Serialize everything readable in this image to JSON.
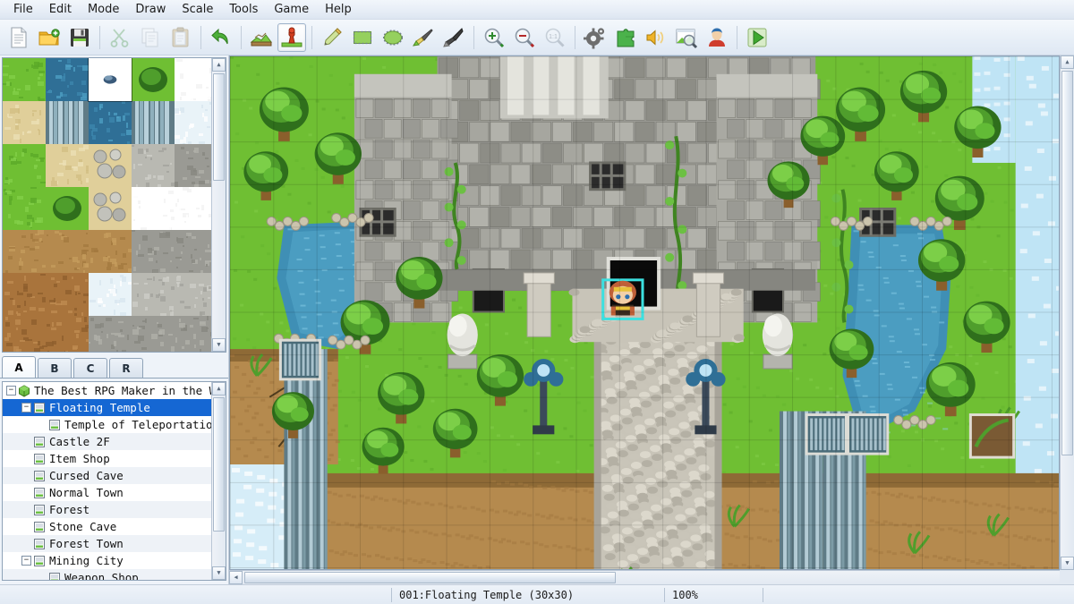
{
  "app": {
    "title": "The Best RPG Maker in the World"
  },
  "menubar": {
    "items": [
      {
        "label": "File"
      },
      {
        "label": "Edit"
      },
      {
        "label": "Mode"
      },
      {
        "label": "Draw"
      },
      {
        "label": "Scale"
      },
      {
        "label": "Tools"
      },
      {
        "label": "Game"
      },
      {
        "label": "Help"
      }
    ]
  },
  "toolbar": {
    "groups": [
      {
        "buttons": [
          {
            "name": "new-project-button",
            "icon": "new-document-icon",
            "enabled": true,
            "active": false
          },
          {
            "name": "open-project-button",
            "icon": "open-folder-icon",
            "enabled": true,
            "active": false
          },
          {
            "name": "save-project-button",
            "icon": "floppy-save-icon",
            "enabled": true,
            "active": false
          }
        ]
      },
      {
        "buttons": [
          {
            "name": "cut-button",
            "icon": "scissors-icon",
            "enabled": false,
            "active": false
          },
          {
            "name": "copy-button",
            "icon": "copy-pages-icon",
            "enabled": false,
            "active": false
          },
          {
            "name": "paste-button",
            "icon": "clipboard-icon",
            "enabled": false,
            "active": false
          }
        ]
      },
      {
        "buttons": [
          {
            "name": "undo-button",
            "icon": "undo-arrow-icon",
            "enabled": true,
            "active": false
          }
        ]
      },
      {
        "buttons": [
          {
            "name": "map-mode-button",
            "icon": "map-layer-icon",
            "enabled": true,
            "active": false
          },
          {
            "name": "event-mode-button",
            "icon": "event-pawn-icon",
            "enabled": true,
            "active": true
          }
        ]
      },
      {
        "buttons": [
          {
            "name": "pencil-tool-button",
            "icon": "pencil-icon",
            "enabled": true,
            "active": false
          },
          {
            "name": "rectangle-tool-button",
            "icon": "rectangle-icon",
            "enabled": true,
            "active": false
          },
          {
            "name": "ellipse-tool-button",
            "icon": "ellipse-icon",
            "enabled": true,
            "active": false
          },
          {
            "name": "flood-fill-tool-button",
            "icon": "paint-brush-icon",
            "enabled": true,
            "active": false
          },
          {
            "name": "shadow-pen-tool-button",
            "icon": "shadow-pen-icon",
            "enabled": true,
            "active": false
          }
        ]
      },
      {
        "buttons": [
          {
            "name": "zoom-in-button",
            "icon": "magnifier-plus-icon",
            "enabled": true,
            "active": false
          },
          {
            "name": "zoom-out-button",
            "icon": "magnifier-minus-icon",
            "enabled": true,
            "active": false
          },
          {
            "name": "zoom-actual-button",
            "icon": "magnifier-one-to-one-icon",
            "enabled": false,
            "active": false
          }
        ]
      },
      {
        "buttons": [
          {
            "name": "database-button",
            "icon": "gear-icon",
            "enabled": true,
            "active": false
          },
          {
            "name": "plugin-manager-button",
            "icon": "puzzle-piece-icon",
            "enabled": true,
            "active": false
          },
          {
            "name": "sound-test-button",
            "icon": "speaker-icon",
            "enabled": true,
            "active": false
          },
          {
            "name": "resource-manager-button",
            "icon": "image-search-icon",
            "enabled": true,
            "active": false
          },
          {
            "name": "character-generator-button",
            "icon": "character-avatar-icon",
            "enabled": true,
            "active": false
          }
        ]
      },
      {
        "buttons": [
          {
            "name": "playtest-button",
            "icon": "green-play-icon",
            "enabled": true,
            "active": false
          }
        ]
      }
    ]
  },
  "tileset": {
    "selected_tile_index": 2,
    "tabs": [
      {
        "label": "A",
        "selected": true
      },
      {
        "label": "B",
        "selected": false
      },
      {
        "label": "C",
        "selected": false
      },
      {
        "label": "R",
        "selected": false
      }
    ]
  },
  "maptree": {
    "items": [
      {
        "label": "The Best RPG Maker in the World",
        "depth": 0,
        "icon": "project-cube-icon",
        "expander": "minus",
        "selected": false
      },
      {
        "label": "Floating Temple",
        "depth": 1,
        "icon": "map-page-icon",
        "expander": "minus",
        "selected": true
      },
      {
        "label": "Temple of Teleportation",
        "depth": 2,
        "icon": "map-page-icon",
        "expander": "none",
        "selected": false
      },
      {
        "label": "Castle 2F",
        "depth": 1,
        "icon": "map-page-icon",
        "expander": "none",
        "selected": false
      },
      {
        "label": "Item Shop",
        "depth": 1,
        "icon": "map-page-icon",
        "expander": "none",
        "selected": false
      },
      {
        "label": "Cursed Cave",
        "depth": 1,
        "icon": "map-page-icon",
        "expander": "none",
        "selected": false
      },
      {
        "label": "Normal Town",
        "depth": 1,
        "icon": "map-page-icon",
        "expander": "none",
        "selected": false
      },
      {
        "label": "Forest",
        "depth": 1,
        "icon": "map-page-icon",
        "expander": "none",
        "selected": false
      },
      {
        "label": "Stone Cave",
        "depth": 1,
        "icon": "map-page-icon",
        "expander": "none",
        "selected": false
      },
      {
        "label": "Forest Town",
        "depth": 1,
        "icon": "map-page-icon",
        "expander": "none",
        "selected": false
      },
      {
        "label": "Mining City",
        "depth": 1,
        "icon": "map-page-icon",
        "expander": "minus",
        "selected": false
      },
      {
        "label": "Weapon Shop",
        "depth": 2,
        "icon": "map-page-icon",
        "expander": "none",
        "selected": false
      }
    ]
  },
  "statusbar": {
    "map_info": "001:Floating Temple (30x30)",
    "zoom": "100%"
  },
  "colors": {
    "selection_blue": "#1567d3",
    "event_select_cyan": "#3ce0e0",
    "panel_bg": "#eef3f9",
    "grass": "#6fc13a",
    "water": "#3f8fb5",
    "sky": "#bfe4f5",
    "stone": "#9a9a94",
    "dirt": "#b9914f"
  }
}
